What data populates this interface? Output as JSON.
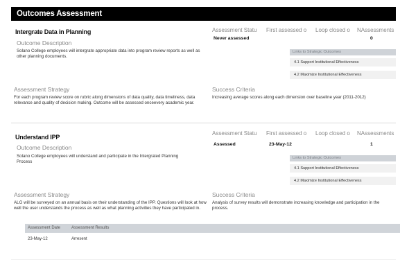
{
  "header": {
    "title": "Outcomes Assessment"
  },
  "columns": {
    "status": "Assessment Statu",
    "first": "First assessed o",
    "loop": "Loop closed o",
    "num": "NAssessments"
  },
  "labels": {
    "outcome_description": "Outcome Description",
    "assessment_strategy": "Assessment Strategy",
    "success_criteria": "Success Criteria",
    "links_head": "Links to Strategic Outcomes",
    "results_date": "Assessment Date",
    "results_results": "Assessment Results"
  },
  "outcomes": [
    {
      "title": "Intergrate Data in Planning",
      "description": "Solano College employees will intergrate appropriate data into program review reports as well as other planning documents.",
      "status": "Never assessed",
      "first": "",
      "loop": "",
      "num": "0",
      "links": [
        "4.1 Support Institutional Effectiveness",
        "4.2 Maximize Institutional Effectiveness"
      ],
      "strategy": "For each program review score on rubric along dimensions of data quality, data timeliness, data relevance and quality of decision making. Outcome will be assessed onceevery academic year.",
      "criteria": "Increasing average scores along each dimension over baseline year (2011-2012)"
    },
    {
      "title": "Understand IPP",
      "description": "Solano College employees will understand and participate in the Intergrated Planning Process",
      "status": "Assessed",
      "first": "23-May-12",
      "loop": "",
      "num": "1",
      "links": [
        "4.1 Support Institutional Effectiveness",
        "4.2 Maximize Institutional Effectiveness"
      ],
      "strategy": "ALG will be surveyed on an annual basis on their understanding of the IPP. Questions will look at how well the user understands the process as well as what planning activities they have participated in.",
      "criteria": "Analysis of survey results will demonstrate increasing knowledge and participation in the process.",
      "results": [
        {
          "date": "23-May-12",
          "result": "Arresent"
        }
      ]
    }
  ]
}
